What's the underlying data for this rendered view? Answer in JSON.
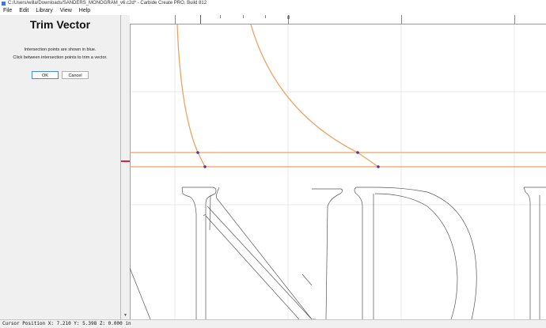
{
  "window": {
    "title": "C:/Users/willa/Downloads/SANDERS_MONOGRAM_v6.c2d* - Carbide Create PRO, Build 812"
  },
  "menu": [
    "File",
    "Edit",
    "Library",
    "View",
    "Help"
  ],
  "panel": {
    "title": "Trim Vector",
    "line1": "Intersection points are shown in blue.",
    "line2": "Click between intersection points to trim a vector.",
    "ok_label": "OK",
    "cancel_label": "Cancel"
  },
  "ruler": {
    "label": "8"
  },
  "status": {
    "text": "Cursor Position X: 7.210 Y: 5.398 Z: 0.000 in"
  },
  "colors": {
    "vector": "#f0a060",
    "intersection": "#4a3a9a",
    "grid": "#e3e3e3",
    "outline": "#555555",
    "marker": "#e0203a"
  }
}
